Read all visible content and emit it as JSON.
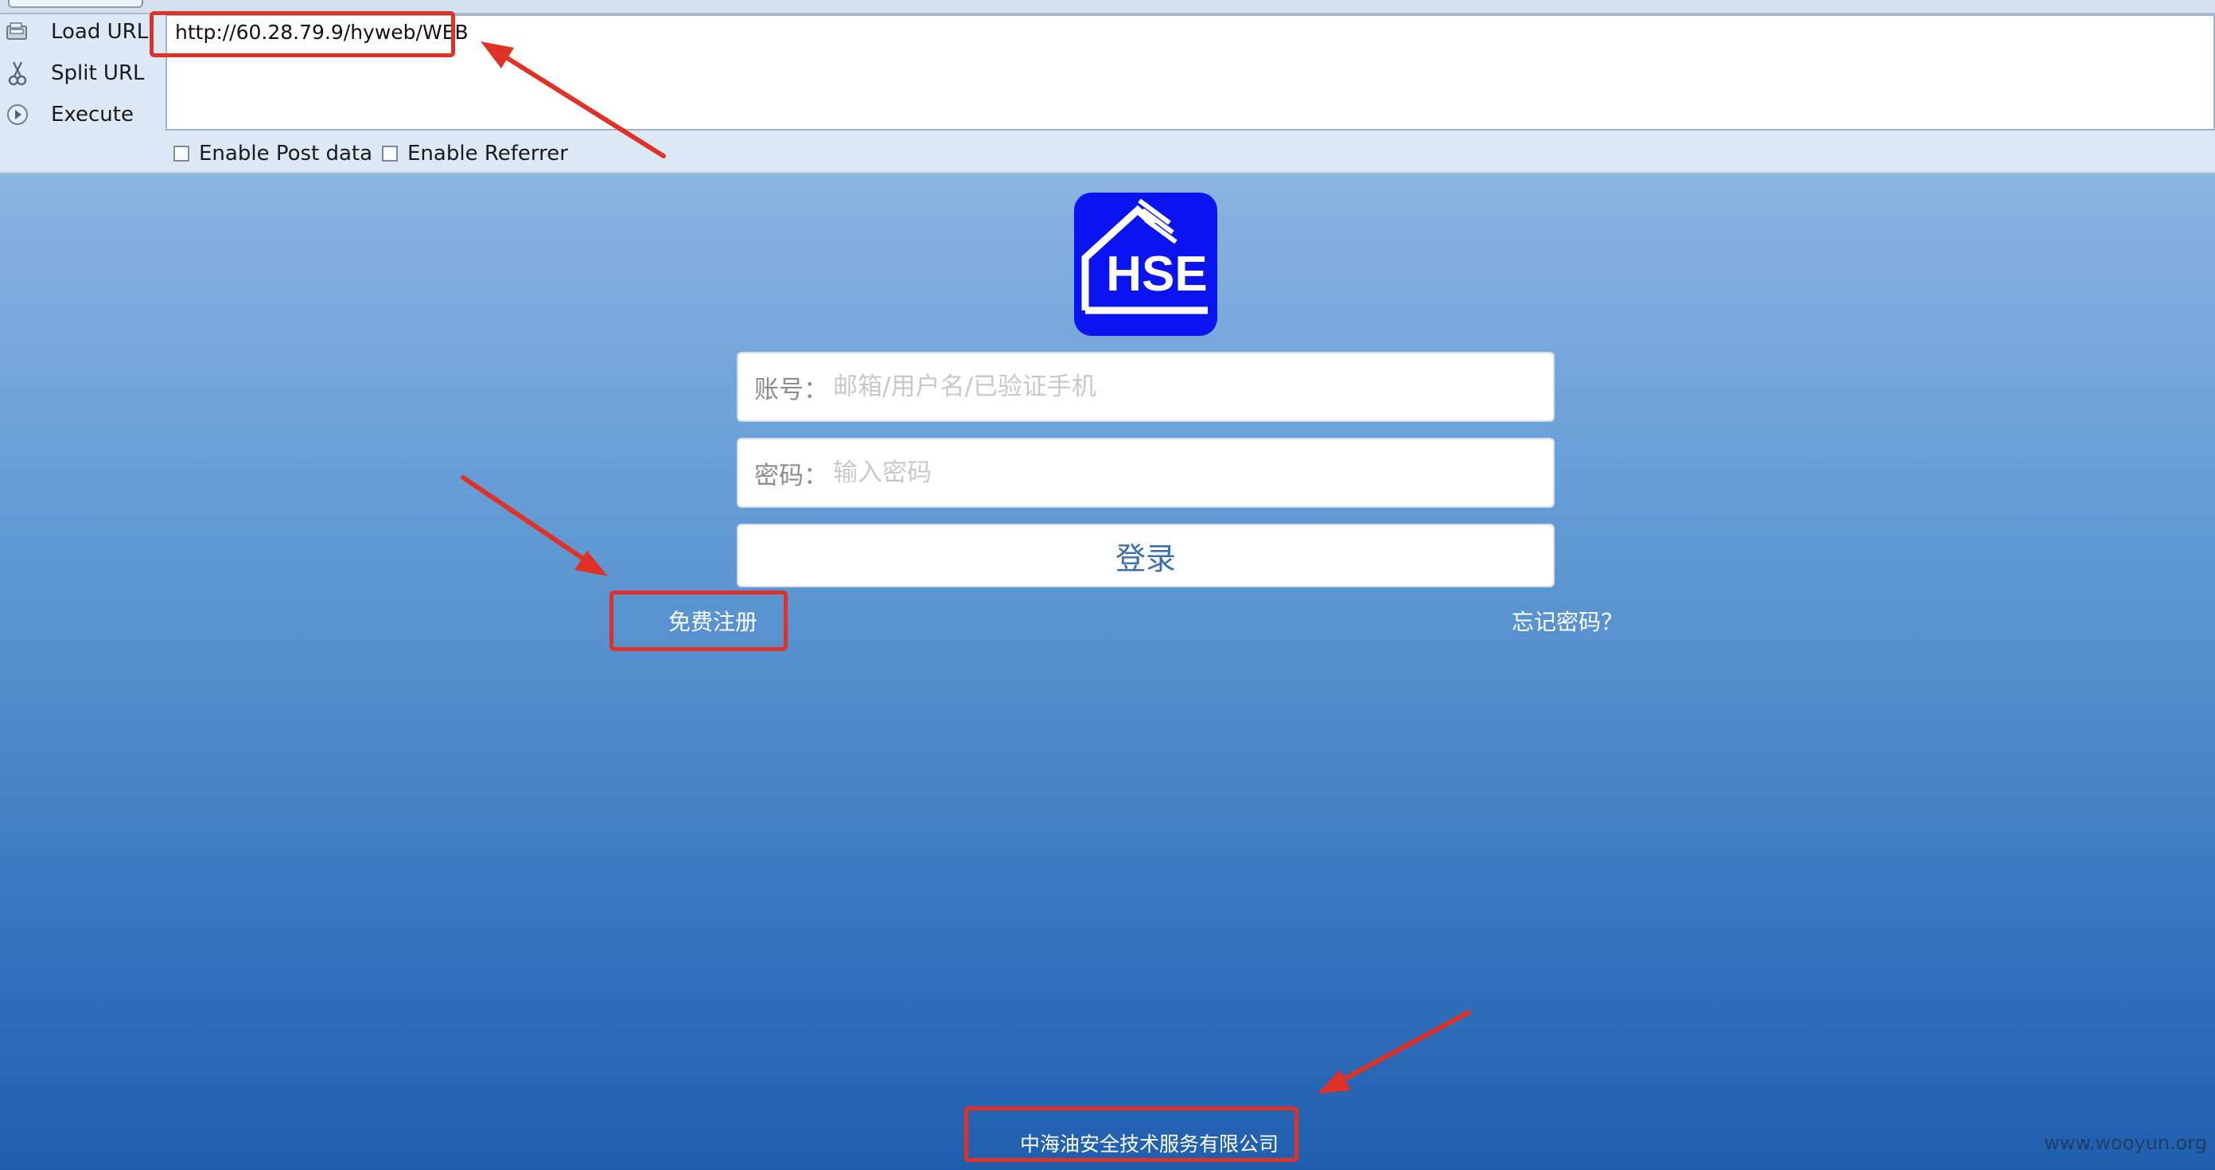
{
  "hackbar": {
    "load_url_label": "Load URL",
    "split_url_label": "Split URL",
    "execute_label": "Execute",
    "url_value": "http://60.28.79.9/hyweb/WEB",
    "enable_post_label": "Enable Post data",
    "enable_referrer_label": "Enable Referrer",
    "enable_post_checked": false,
    "enable_referrer_checked": false
  },
  "login": {
    "logo_text": "HSE",
    "account_label": "账号：",
    "account_placeholder": "邮箱/用户名/已验证手机",
    "password_label": "密码：",
    "password_placeholder": "输入密码",
    "login_button": "登录",
    "register_link": "免费注册",
    "forgot_link": "忘记密码？"
  },
  "footer": {
    "company": "中海油安全技术服务有限公司"
  },
  "watermark": "www.wooyun.org",
  "colors": {
    "annotation_red": "#e03126",
    "logo_blue": "#0a14f0",
    "page_gradient_top": "#8ab4e1",
    "page_gradient_bottom": "#1f5fae"
  }
}
